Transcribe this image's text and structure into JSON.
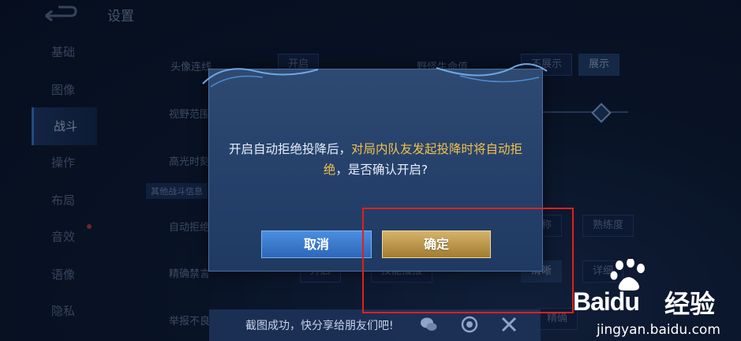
{
  "header": {
    "title": "设置"
  },
  "sidebar": {
    "items": [
      {
        "label": "基础",
        "active": false,
        "dot": false
      },
      {
        "label": "图像",
        "active": false,
        "dot": false
      },
      {
        "label": "战斗",
        "active": true,
        "dot": false
      },
      {
        "label": "操作",
        "active": false,
        "dot": false
      },
      {
        "label": "布局",
        "active": false,
        "dot": false
      },
      {
        "label": "音效",
        "active": false,
        "dot": true
      },
      {
        "label": "语像",
        "active": false,
        "dot": false
      },
      {
        "label": "隐私",
        "active": false,
        "dot": false
      }
    ]
  },
  "background": {
    "avatar_link_label": "头像连线",
    "avatar_link_toggle": "开启",
    "wild_hp_label": "野怪生命值",
    "wild_hp_off": "不展示",
    "wild_hp_on": "展示",
    "view_range_label": "视野范围",
    "highlight_label": "高光时刻",
    "section_label": "其他战斗信息",
    "auto_reject_label": "自动拒绝",
    "auto_reject_opt1": "名称",
    "auto_reject_opt2": "熟练度",
    "precise_label": "精确禁言",
    "precise_opt1": "开启",
    "precise_opt2": "技能播报",
    "precise_opt3": "清晰",
    "precise_opt4": "详细",
    "report_label": "举报不良",
    "report_opt": "精确"
  },
  "modal": {
    "message_part1": "开启自动拒绝投降后，",
    "message_highlight": "对局内队友发起投降时将自动拒绝",
    "message_part2": "，是否确认开启?",
    "cancel_label": "取消",
    "confirm_label": "确定",
    "accent_color": "#f2c24a"
  },
  "share_bar": {
    "text": "截图成功，快分享给朋友们吧!",
    "icons": [
      "wechat-icon",
      "camera-icon",
      "close-icon"
    ]
  },
  "watermark": {
    "brand": "Bai",
    "brand_suffix": "du",
    "cn": "经验",
    "url": "jingyan.baidu.com"
  },
  "annotation": {
    "color": "#e0201b"
  }
}
